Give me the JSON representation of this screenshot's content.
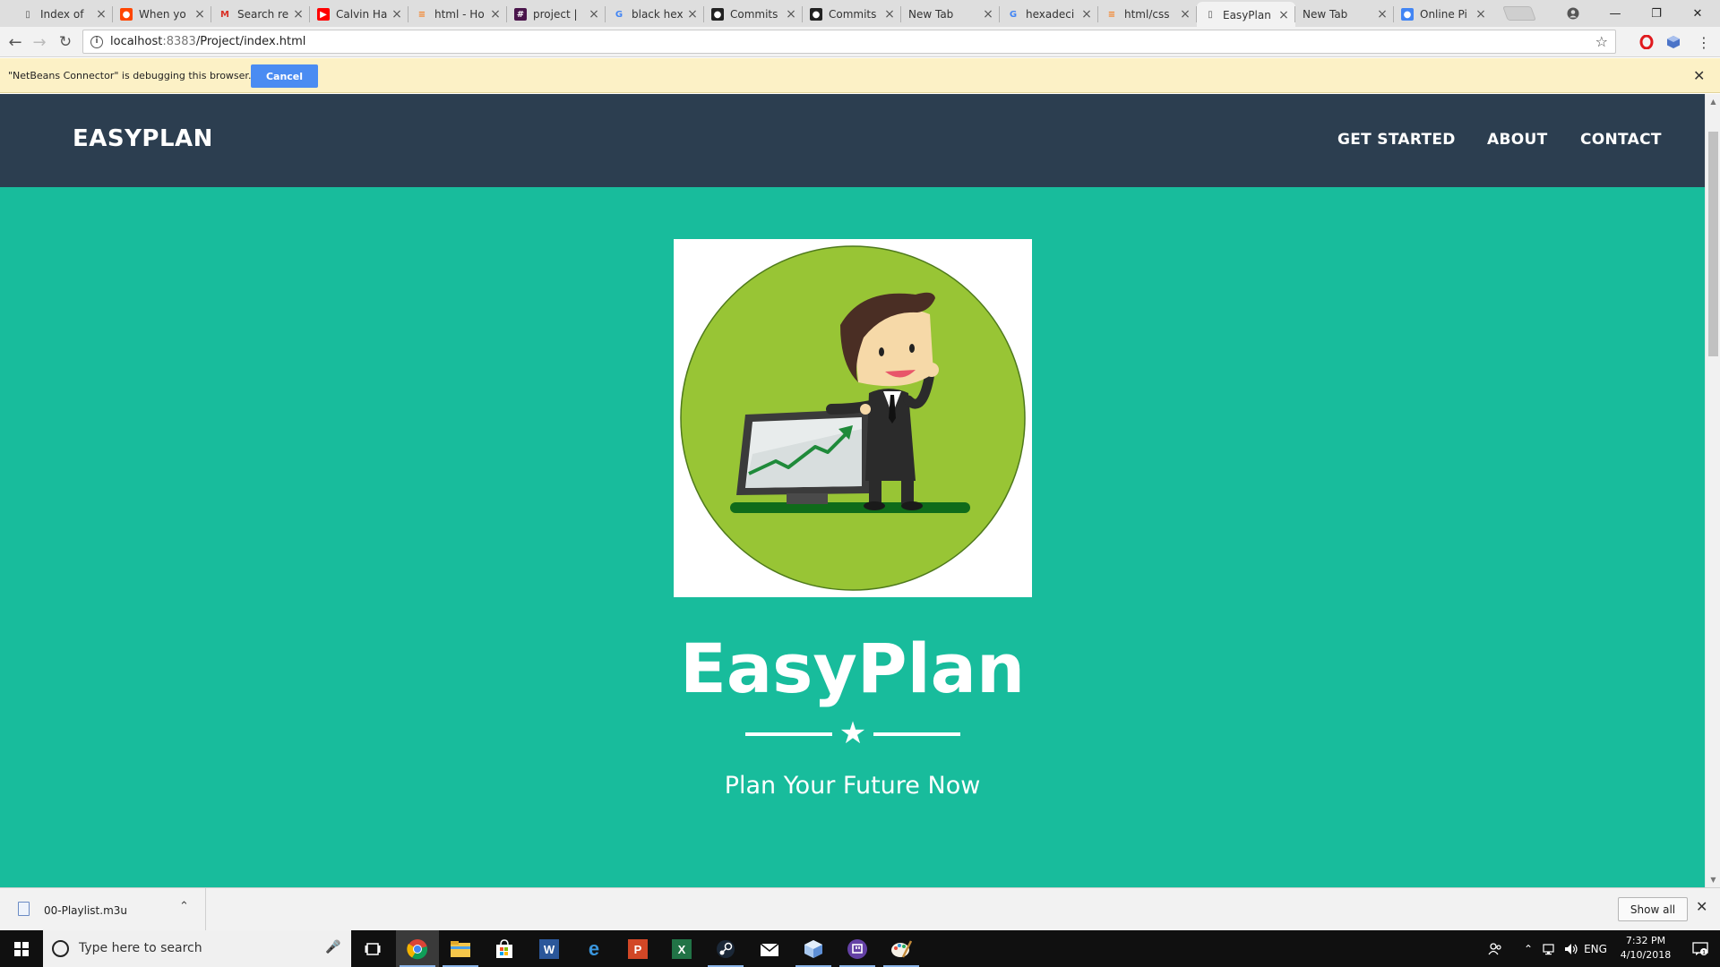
{
  "browser": {
    "tabs": [
      {
        "title": "Index of",
        "favicon": "page-icon"
      },
      {
        "title": "When yo",
        "favicon": "reddit-icon"
      },
      {
        "title": "Search re",
        "favicon": "gmail-icon"
      },
      {
        "title": "Calvin Ha",
        "favicon": "youtube-icon"
      },
      {
        "title": "html - Ho",
        "favicon": "stackoverflow-icon"
      },
      {
        "title": "project |",
        "favicon": "slack-icon"
      },
      {
        "title": "black hex",
        "favicon": "google-icon"
      },
      {
        "title": "Commits",
        "favicon": "github-icon"
      },
      {
        "title": "Commits",
        "favicon": "github-icon"
      },
      {
        "title": "New Tab",
        "favicon": ""
      },
      {
        "title": "hexadeci",
        "favicon": "google-icon"
      },
      {
        "title": "html/css",
        "favicon": "stackoverflow-icon"
      },
      {
        "title": "EasyPlan",
        "favicon": "page-icon",
        "active": true
      },
      {
        "title": "New Tab",
        "favicon": ""
      },
      {
        "title": "Online Pi",
        "favicon": "chrome-icon"
      }
    ],
    "url_host": "localhost",
    "url_port": ":8383",
    "url_path": "/Project/index.html",
    "debug_message": "\"NetBeans Connector\" is debugging this browser.",
    "debug_cancel": "Cancel"
  },
  "site": {
    "brand": "EASYPLAN",
    "nav": [
      "GET STARTED",
      "ABOUT",
      "CONTACT"
    ],
    "hero_title": "EasyPlan",
    "hero_subtitle": "Plan Your Future Now"
  },
  "downloads": {
    "file": "00-Playlist.m3u",
    "show_all": "Show all"
  },
  "taskbar": {
    "search_placeholder": "Type here to search",
    "language": "ENG",
    "time": "7:32 PM",
    "date": "4/10/2018"
  },
  "colors": {
    "navbar": "#2c3e50",
    "hero": "#18bc9c",
    "accent_green": "#98c535"
  }
}
